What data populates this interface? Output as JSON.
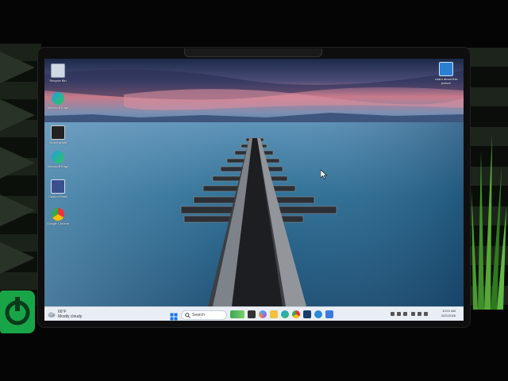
{
  "desktop": {
    "icons_left": [
      {
        "label": "Recycle Bin",
        "icon": "recycle-bin-icon"
      },
      {
        "label": "Microsoft Edge",
        "icon": "edge-icon"
      },
      {
        "label": "Screenshots",
        "icon": "folder-icon"
      },
      {
        "label": "Microsoft Edge",
        "icon": "edge-icon"
      },
      {
        "label": "Control Panel",
        "icon": "control-panel-icon"
      },
      {
        "label": "Google Chrome",
        "icon": "chrome-icon"
      }
    ],
    "icon_right": {
      "label": "Learn about this picture",
      "icon": "learn-picture-icon"
    }
  },
  "taskbar": {
    "weather_temp": "66°F",
    "weather_condition": "Mostly cloudy",
    "search_placeholder": "Search",
    "apps": [
      "start-icon",
      "search-icon",
      "widgets-icon",
      "task-view-icon",
      "copilot-icon",
      "file-explorer-icon",
      "edge-icon",
      "chrome-icon",
      "store-icon",
      "edge-beta-icon",
      "photos-icon"
    ],
    "time": "10:01 AM",
    "date": "5/21/2026"
  },
  "colors": {
    "taskbar_bg": "#e9eef4",
    "sky_top": "#1c2a4a",
    "sunset": "#c97a8a",
    "water": "#2e6f95",
    "status_green": "#18a548"
  }
}
